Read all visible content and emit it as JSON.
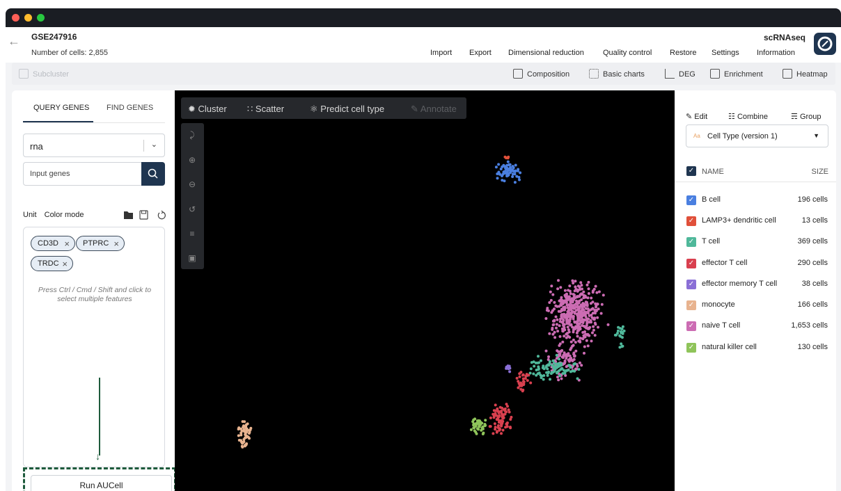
{
  "window": {
    "traffic_lights": [
      "#ff5f57",
      "#febc2e",
      "#28c840"
    ]
  },
  "header": {
    "dataset_title": "GSE247916",
    "cell_count": "Number of cells: 2,855",
    "app_type": "scRNAseq",
    "menu": [
      "Import",
      "Export",
      "Dimensional reduction",
      "Quality control",
      "Restore",
      "Settings",
      "Information"
    ]
  },
  "toolbar": {
    "subcluster_label": "Subcluster",
    "tools": [
      "Composition",
      "Basic charts",
      "DEG",
      "Enrichment",
      "Heatmap"
    ]
  },
  "left_panel": {
    "tabs": [
      "QUERY GENES",
      "FIND GENES"
    ],
    "active_tab": "QUERY GENES",
    "assay_select_value": "rna",
    "gene_input_placeholder": "Input genes",
    "unit_label": "Unit",
    "color_mode_label": "Color mode",
    "selected_genes": [
      "CD3D",
      "PTPRC",
      "TRDC"
    ],
    "hint_text": "Press Ctrl / Cmd / Shift and click to select multiple features",
    "run_button_label": "Run AUCell",
    "highlight_color": "#1e5b3c"
  },
  "plot": {
    "toolbar": [
      "Cluster",
      "Scatter",
      "Predict cell type",
      "Annotate"
    ],
    "disabled_tools": [
      "Annotate"
    ],
    "background": "#000000"
  },
  "right_panel": {
    "actions": [
      "Edit",
      "Combine",
      "Group"
    ],
    "annotation_select_value": "Cell Type (version 1)",
    "column_name": "NAME",
    "column_size": "SIZE",
    "cell_types": [
      {
        "name": "B cell",
        "size": "196 cells",
        "color": "#4a7fe0"
      },
      {
        "name": "LAMP3+ dendritic cell",
        "size": "13 cells",
        "color": "#e0503a"
      },
      {
        "name": "T cell",
        "size": "369 cells",
        "color": "#4fb89a"
      },
      {
        "name": "effector T cell",
        "size": "290 cells",
        "color": "#d9404f"
      },
      {
        "name": "effector memory T cell",
        "size": "38 cells",
        "color": "#8a6fd6"
      },
      {
        "name": "monocyte",
        "size": "166 cells",
        "color": "#e8b38f"
      },
      {
        "name": "naive T cell",
        "size": "1,653 cells",
        "color": "#cc6cb3"
      },
      {
        "name": "natural killer cell",
        "size": "130 cells",
        "color": "#8fc45a"
      }
    ]
  }
}
